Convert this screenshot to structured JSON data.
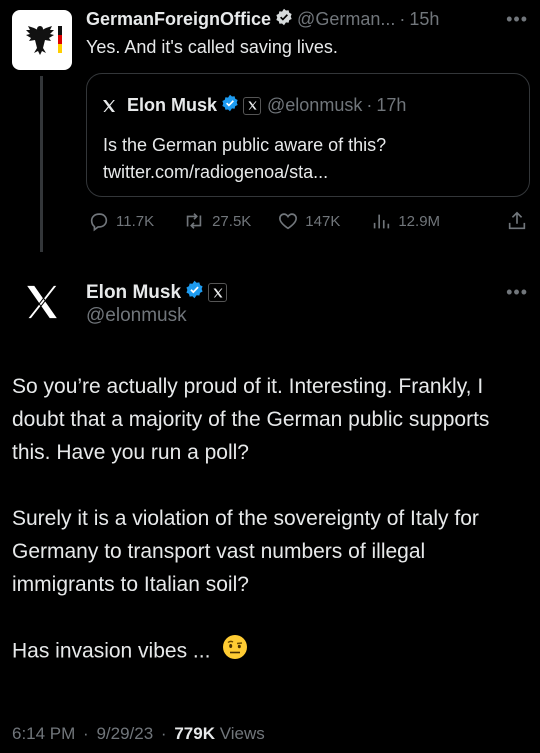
{
  "reply": {
    "author_name": "GermanForeignOffice",
    "author_handle": "@German...",
    "separator": "·",
    "time": "15h",
    "more": "•••",
    "text": "Yes. And it's called saving lives."
  },
  "quote": {
    "author_name": "Elon Musk",
    "author_handle": "@elonmusk",
    "separator": "·",
    "time": "17h",
    "text_line1": "Is the German public aware of this?",
    "text_line2": "twitter.com/radiogenoa/sta..."
  },
  "actions": {
    "replies": "11.7K",
    "retweets": "27.5K",
    "likes": "147K",
    "views": "12.9M"
  },
  "main_tweet": {
    "author_name": "Elon Musk",
    "author_handle": "@elonmusk",
    "more": "•••",
    "paragraph1": "So you’re actually proud of it. Interesting. Frankly, I doubt that a majority of the German public supports this. Have you run a poll?",
    "paragraph2": "Surely it is a violation of the sovereignty of Italy for Germany to transport vast numbers of illegal immigrants to Italian soil?",
    "paragraph3": "Has invasion vibes ...",
    "time": "6:14 PM",
    "separator": "·",
    "date": "9/29/23",
    "views_count": "779K",
    "views_label": "Views"
  },
  "colors": {
    "background": "#000000",
    "text": "#e7e9ea",
    "secondary": "#71767b",
    "verified_blue": "#1d9bf0",
    "german_gold": "#ffce00",
    "german_red": "#dd0000"
  }
}
